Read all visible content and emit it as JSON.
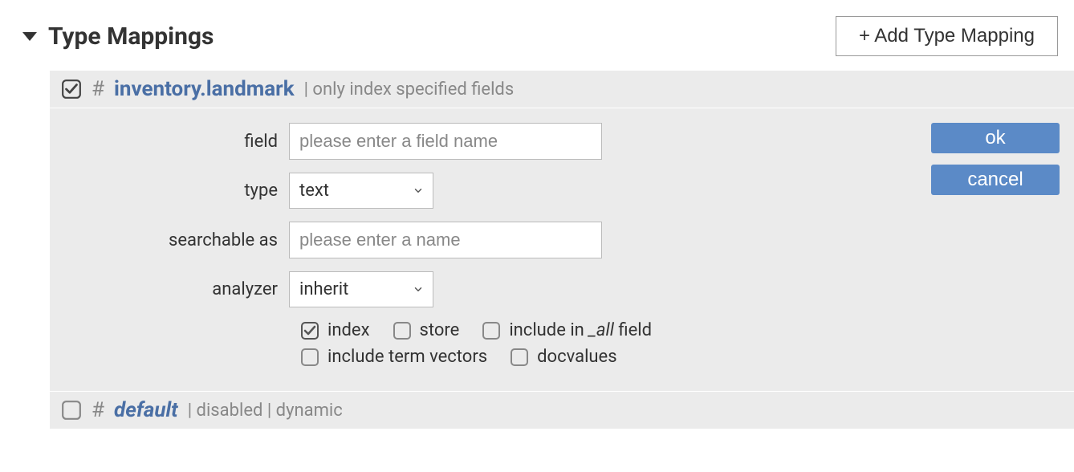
{
  "header": {
    "title": "Type Mappings",
    "add_button": "+ Add Type Mapping"
  },
  "mappings": [
    {
      "checked": true,
      "name": "inventory.landmark",
      "meta": "| only index specified fields",
      "italic": false
    },
    {
      "checked": false,
      "name": "default",
      "meta": "| disabled | dynamic",
      "italic": true
    }
  ],
  "form": {
    "labels": {
      "field": "field",
      "type": "type",
      "searchable_as": "searchable as",
      "analyzer": "analyzer"
    },
    "placeholders": {
      "field": "please enter a field name",
      "searchable_as": "please enter a name"
    },
    "values": {
      "type": "text",
      "analyzer": "inherit"
    },
    "checkboxes": {
      "index": {
        "label": "index",
        "checked": true
      },
      "store": {
        "label": "store",
        "checked": false
      },
      "include_in_all_pre": "include in ",
      "include_in_all_italic": "_all",
      "include_in_all_post": " field",
      "include_in_all_checked": false,
      "include_term_vectors": {
        "label": "include term vectors",
        "checked": false
      },
      "docvalues": {
        "label": "docvalues",
        "checked": false
      }
    },
    "buttons": {
      "ok": "ok",
      "cancel": "cancel"
    }
  }
}
